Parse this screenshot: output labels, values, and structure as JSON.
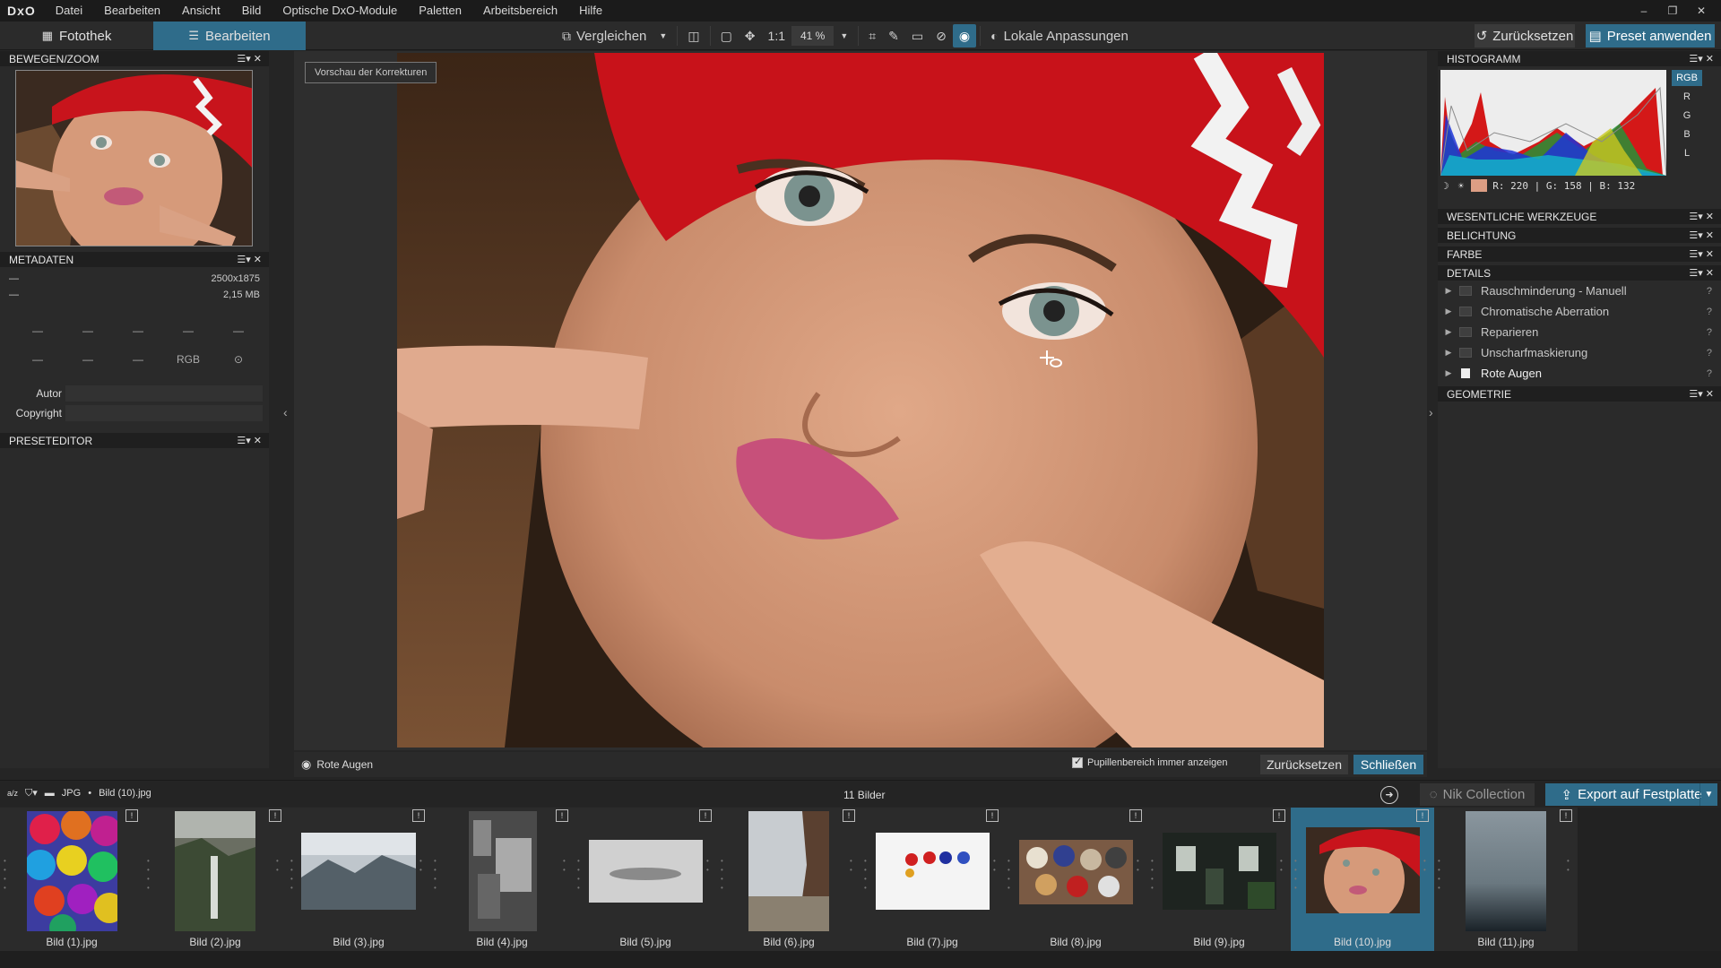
{
  "app": {
    "logo": "DxO"
  },
  "menu": [
    "Datei",
    "Bearbeiten",
    "Ansicht",
    "Bild",
    "Optische DxO-Module",
    "Paletten",
    "Arbeitsbereich",
    "Hilfe"
  ],
  "window_controls": {
    "minimize": "–",
    "restore": "❐",
    "close": "✕"
  },
  "tabs": {
    "library": "Fotothek",
    "edit": "Bearbeiten"
  },
  "toolbar": {
    "compare": "Vergleichen",
    "one_to_one": "1:1",
    "zoom": "41 %",
    "local_adjust": "Lokale Anpassungen",
    "reset": "Zurücksetzen",
    "apply_preset": "Preset anwenden"
  },
  "left_panel": {
    "move_zoom_title": "BEWEGEN/ZOOM",
    "metadata_title": "METADATEN",
    "meta_dim_label": "—",
    "meta_dim_value": "2500x1875",
    "meta_size_label": "—",
    "meta_size_value": "2,15 MB",
    "meta_grid": [
      "—",
      "—",
      "—",
      "—",
      "—",
      "—",
      "—",
      "—",
      "RGB",
      ""
    ],
    "author_label": "Autor",
    "copyright_label": "Copyright",
    "preset_editor_title": "PRESETEDITOR"
  },
  "viewer": {
    "preview_label": "Vorschau der Korrekturen",
    "footer_tool": "Rote Augen",
    "pupil_checkbox": "Pupillenbereich immer anzeigen",
    "reset": "Zurücksetzen",
    "close": "Schließen"
  },
  "right_panel": {
    "histogram_title": "HISTOGRAMM",
    "channels": [
      "RGB",
      "R",
      "G",
      "B",
      "L"
    ],
    "pixel_info": "R: 220 | G: 158 | B: 132",
    "sections": {
      "essential": "WESENTLICHE WERKZEUGE",
      "exposure": "BELICHTUNG",
      "color": "FARBE",
      "details": "DETAILS",
      "geometry": "GEOMETRIE"
    },
    "detail_tools": [
      {
        "label": "Rauschminderung - Manuell",
        "help": "?"
      },
      {
        "label": "Chromatische Aberration",
        "help": "?"
      },
      {
        "label": "Reparieren",
        "help": "?"
      },
      {
        "label": "Unscharfmaskierung",
        "help": "?"
      },
      {
        "label": "Rote Augen",
        "help": "?"
      }
    ]
  },
  "filmstrip_bar": {
    "sort_icon_label": "a/z",
    "path_type": "JPG",
    "path_sep": "•",
    "path_file": "Bild (10).jpg",
    "count": "11 Bilder",
    "nik": "Nik Collection",
    "export": "Export auf Festplatte"
  },
  "filmstrip": [
    {
      "label": "Bild (1).jpg"
    },
    {
      "label": "Bild (2).jpg"
    },
    {
      "label": "Bild (3).jpg"
    },
    {
      "label": "Bild (4).jpg"
    },
    {
      "label": "Bild (5).jpg"
    },
    {
      "label": "Bild (6).jpg"
    },
    {
      "label": "Bild (7).jpg"
    },
    {
      "label": "Bild (8).jpg"
    },
    {
      "label": "Bild (9).jpg"
    },
    {
      "label": "Bild (10).jpg"
    },
    {
      "label": "Bild (11).jpg"
    }
  ],
  "colors": {
    "accent": "#2f6c8a",
    "panel": "#2a2a2a",
    "header": "#1f1f1f"
  }
}
